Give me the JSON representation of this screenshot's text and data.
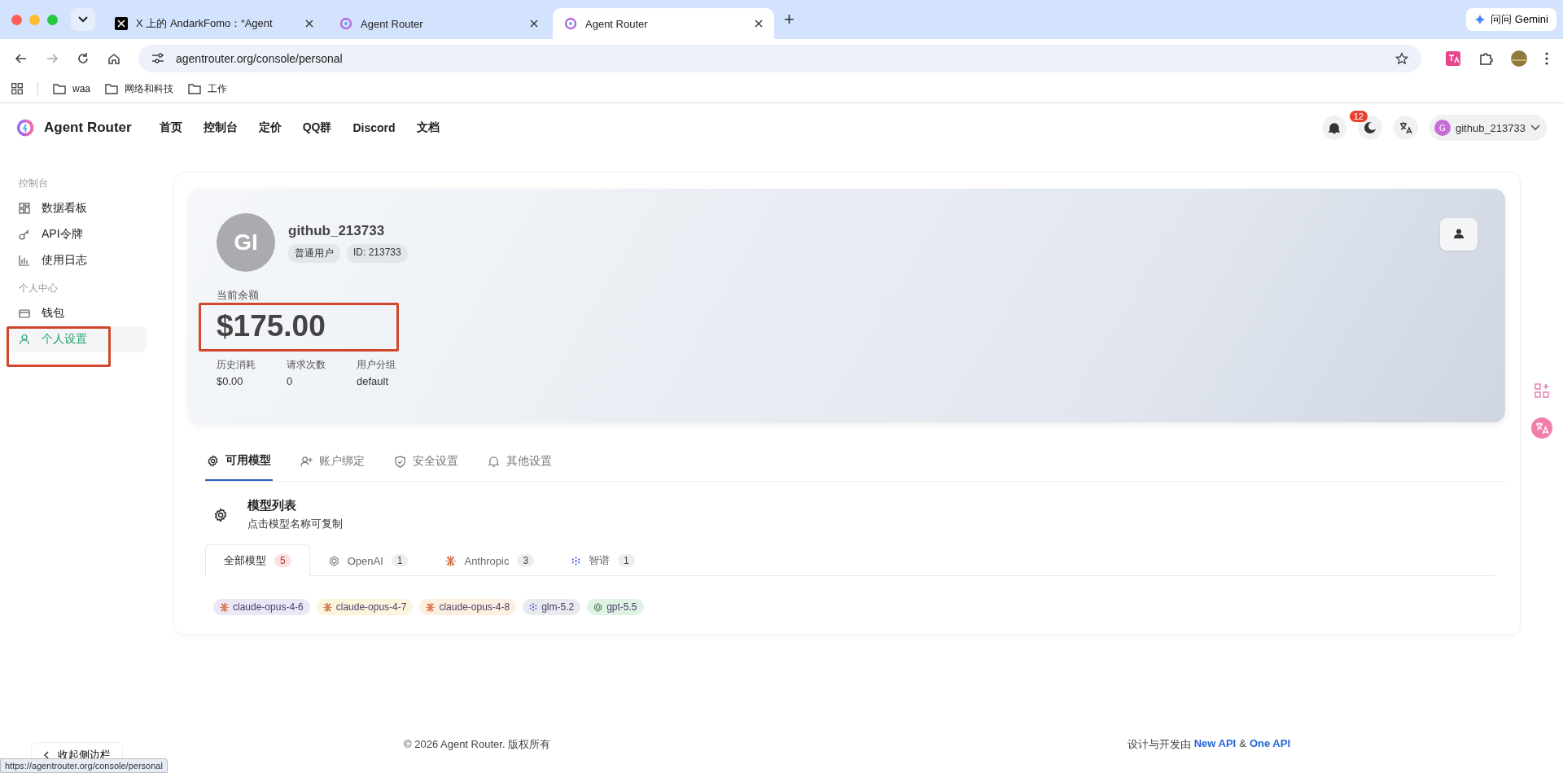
{
  "browser": {
    "tabs": [
      {
        "title": "X 上的 AndarkFomo：“Agent",
        "kind": "x",
        "selected": false
      },
      {
        "title": "Agent Router",
        "kind": "router",
        "selected": false
      },
      {
        "title": "Agent Router",
        "kind": "router",
        "selected": true
      }
    ],
    "new_tab": "+",
    "gemini_button": "问问 Gemini",
    "url": "agentrouter.org/console/personal",
    "bookmarks": [
      "waa",
      "网络和科技",
      "工作"
    ]
  },
  "header": {
    "brand": "Agent Router",
    "nav": [
      "首页",
      "控制台",
      "定价",
      "QQ群",
      "Discord",
      "文档"
    ],
    "notification_count": "12",
    "user_initial": "G",
    "user_name": "github_213733"
  },
  "sidebar": {
    "sections": [
      {
        "title": "控制台",
        "items": [
          {
            "label": "数据看板",
            "kind": "grid",
            "selected": false
          },
          {
            "label": "API令牌",
            "kind": "key",
            "selected": false
          },
          {
            "label": "使用日志",
            "kind": "chart",
            "selected": false
          }
        ]
      },
      {
        "title": "个人中心",
        "items": [
          {
            "label": "钱包",
            "kind": "card",
            "selected": false
          },
          {
            "label": "个人设置",
            "kind": "user",
            "selected": true
          }
        ]
      }
    ],
    "collapse": "收起侧边栏"
  },
  "profile": {
    "avatar": "GI",
    "username": "github_213733",
    "role": "普通用户",
    "id": "ID: 213733",
    "balance_label": "当前余额",
    "balance": "$175.00",
    "stats": [
      {
        "label": "历史消耗",
        "value": "$0.00"
      },
      {
        "label": "请求次数",
        "value": "0"
      },
      {
        "label": "用户分组",
        "value": "default"
      }
    ]
  },
  "settings_tabs": [
    {
      "label": "可用模型",
      "kind": "gear",
      "selected": true
    },
    {
      "label": "账户绑定",
      "kind": "user-plus",
      "selected": false
    },
    {
      "label": "安全设置",
      "kind": "shield",
      "selected": false
    },
    {
      "label": "其他设置",
      "kind": "bell",
      "selected": false
    }
  ],
  "model_list": {
    "title": "模型列表",
    "subtitle": "点击模型名称可复制",
    "filters": [
      {
        "label": "全部模型",
        "count": "5",
        "kind": "all",
        "selected": true
      },
      {
        "label": "OpenAI",
        "count": "1",
        "kind": "openai",
        "selected": false
      },
      {
        "label": "Anthropic",
        "count": "3",
        "kind": "anthropic",
        "selected": false
      },
      {
        "label": "智谱",
        "count": "1",
        "kind": "zhipu",
        "selected": false
      }
    ],
    "models": [
      {
        "name": "claude-opus-4-6",
        "kind": "anthropic",
        "color": "#ebe7f7"
      },
      {
        "name": "claude-opus-4-7",
        "kind": "anthropic",
        "color": "#fcf5dd"
      },
      {
        "name": "claude-opus-4-8",
        "kind": "anthropic",
        "color": "#fcefdf"
      },
      {
        "name": "glm-5.2",
        "kind": "zhipu",
        "color": "#e8eaee"
      },
      {
        "name": "gpt-5.5",
        "kind": "openai",
        "color": "#dff2e4"
      }
    ]
  },
  "footer": {
    "copyright": "© 2026 Agent Router. 版权所有",
    "credit": "设计与开发由",
    "links": [
      "New API",
      "One API"
    ],
    "separator": "&"
  },
  "status_url": "https://agentrouter.org/console/personal"
}
